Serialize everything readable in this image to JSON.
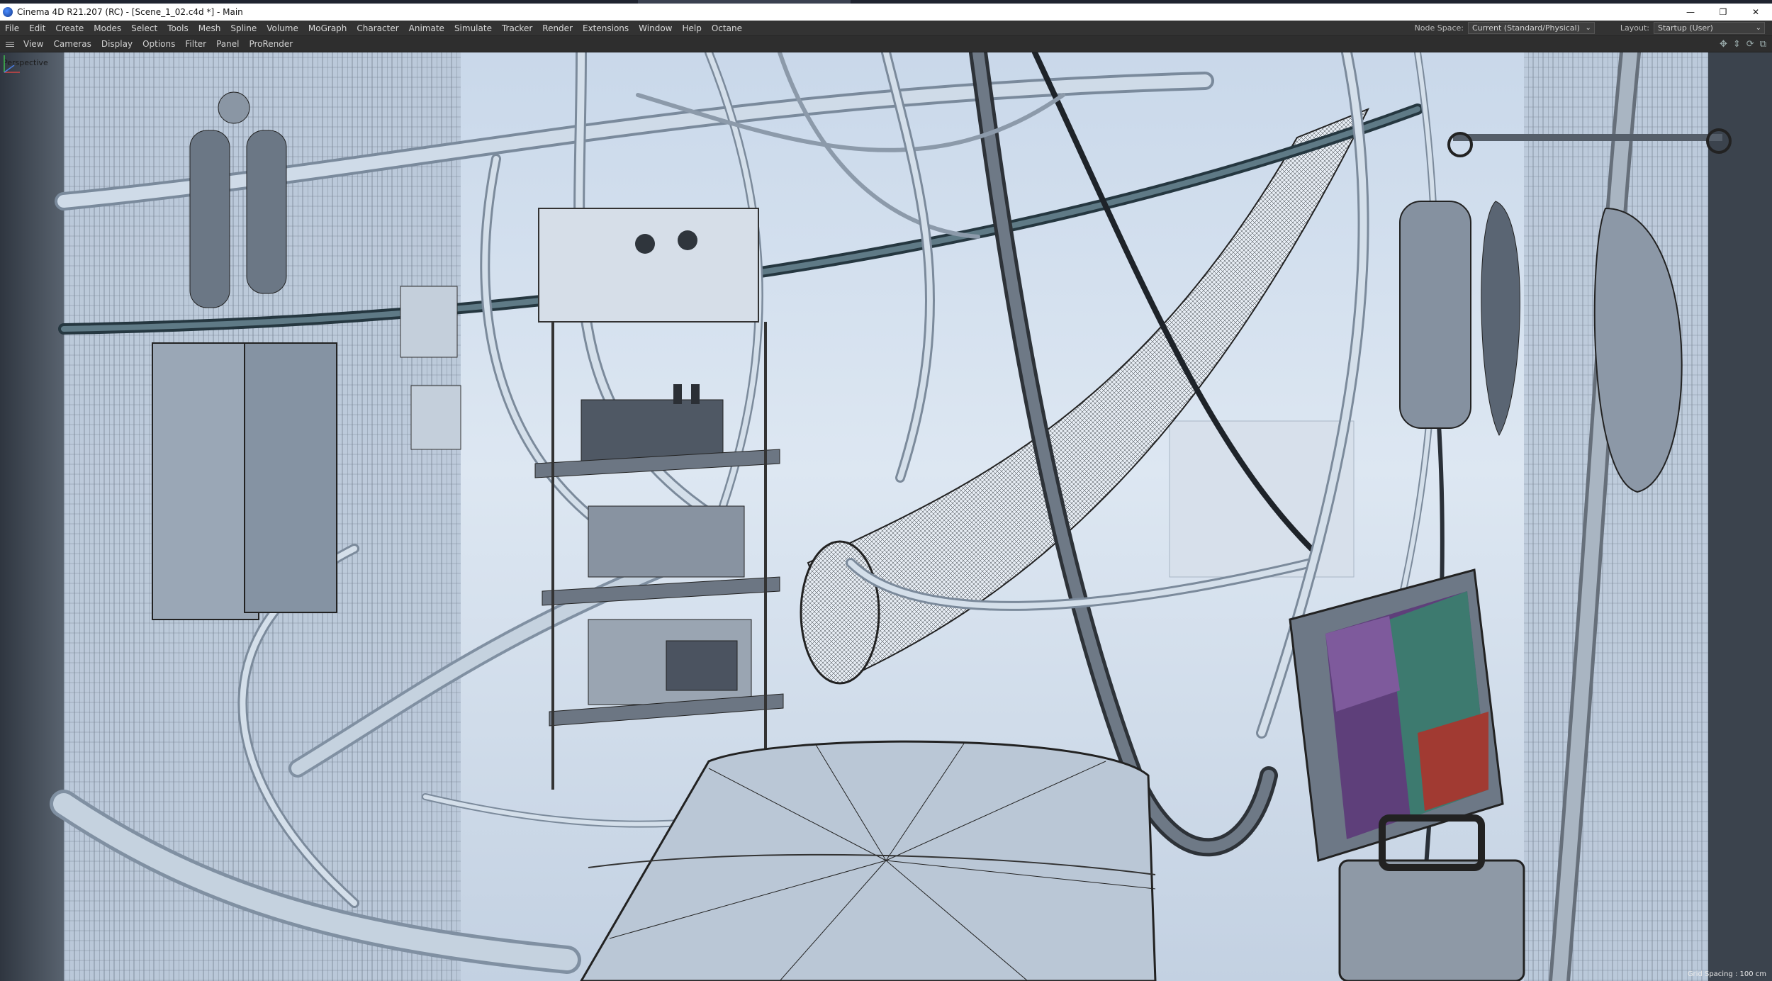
{
  "window": {
    "title": "Cinema 4D R21.207 (RC) - [Scene_1_02.c4d *] - Main",
    "controls": {
      "minimize": "—",
      "restore": "❐",
      "close": "✕"
    }
  },
  "menubar": {
    "items": [
      "File",
      "Edit",
      "Create",
      "Modes",
      "Select",
      "Tools",
      "Mesh",
      "Spline",
      "Volume",
      "MoGraph",
      "Character",
      "Animate",
      "Simulate",
      "Tracker",
      "Render",
      "Extensions",
      "Window",
      "Help",
      "Octane"
    ],
    "node_space_label": "Node Space:",
    "node_space_value": "Current (Standard/Physical)",
    "layout_label": "Layout:",
    "layout_value": "Startup (User)"
  },
  "viewport_menu": {
    "items": [
      "View",
      "Cameras",
      "Display",
      "Options",
      "Filter",
      "Panel",
      "ProRender"
    ],
    "nav_icons": [
      "move-view-icon",
      "zoom-view-icon",
      "rotate-view-icon",
      "toggle-view-icon"
    ]
  },
  "viewport": {
    "camera_label": "Perspective",
    "grid_spacing": "Grid Spacing : 100 cm"
  }
}
